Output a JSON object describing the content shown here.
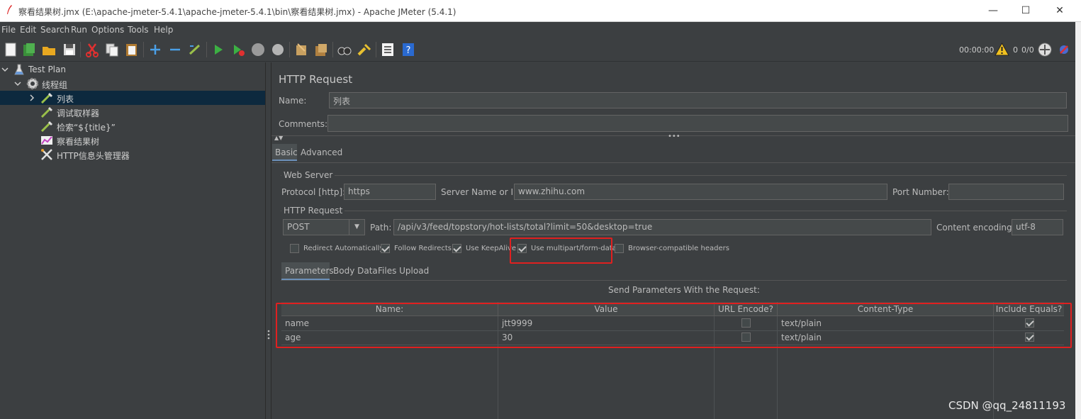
{
  "window": {
    "title": "察看结果树.jmx (E:\\apache-jmeter-5.4.1\\apache-jmeter-5.4.1\\bin\\察看结果树.jmx) - Apache JMeter (5.4.1)",
    "minimize": "—",
    "maximize": "☐",
    "close": "✕"
  },
  "menu": [
    "File",
    "Edit",
    "Search",
    "Run",
    "Options",
    "Tools",
    "Help"
  ],
  "toolbar": {
    "timer": "00:00:00",
    "warnings": "0",
    "threads": "0/0",
    "icons": [
      "new-icon",
      "templates-icon",
      "open-icon",
      "save-icon",
      "cut-icon",
      "copy-icon",
      "paste-icon",
      "expand-icon",
      "collapse-icon",
      "toggle-icon",
      "start-icon",
      "start-no-pause-icon",
      "stop-icon",
      "shutdown-icon",
      "clear-icon",
      "clear-all-icon",
      "search-icon",
      "reset-search-icon",
      "function-helper-icon",
      "help-icon"
    ]
  },
  "tree": {
    "items": [
      {
        "label": "Test Plan",
        "icon": "flask-icon"
      },
      {
        "label": "线程组",
        "icon": "gear-icon"
      },
      {
        "label": "列表",
        "icon": "pipette-icon"
      },
      {
        "label": "调试取样器",
        "icon": "pipette-icon"
      },
      {
        "label": "检索“${title}”",
        "icon": "pipette-icon"
      },
      {
        "label": "察看结果树",
        "icon": "graph-icon"
      },
      {
        "label": "HTTP信息头管理器",
        "icon": "tools-icon"
      }
    ]
  },
  "panel": {
    "title": "HTTP Request",
    "name_label": "Name:",
    "name_value": "列表",
    "comments_label": "Comments:",
    "comments_value": "",
    "tabs": [
      "Basic",
      "Advanced"
    ],
    "web_server": {
      "legend": "Web Server",
      "protocol_label": "Protocol [http]:",
      "protocol_value": "https",
      "server_label": "Server Name or IP:",
      "server_value": "www.zhihu.com",
      "port_label": "Port Number:",
      "port_value": ""
    },
    "http_request": {
      "legend": "HTTP Request",
      "method": "POST",
      "path_label": "Path:",
      "path_value": "/api/v3/feed/topstory/hot-lists/total?limit=50&desktop=true",
      "encoding_label": "Content encoding:",
      "encoding_value": "utf-8"
    },
    "options": [
      {
        "label": "Redirect Automatically",
        "checked": false
      },
      {
        "label": "Follow Redirects",
        "checked": true
      },
      {
        "label": "Use KeepAlive",
        "checked": true
      },
      {
        "label": "Use multipart/form-data",
        "checked": true
      },
      {
        "label": "Browser-compatible headers",
        "checked": false
      }
    ],
    "sub_tabs": [
      "Parameters",
      "Body Data",
      "Files Upload"
    ],
    "params_caption": "Send Parameters With the Request:",
    "columns": [
      "Name:",
      "Value",
      "URL Encode?",
      "Content-Type",
      "Include Equals?"
    ],
    "rows": [
      {
        "name": "name",
        "value": "jtt9999",
        "url_encode": false,
        "content_type": "text/plain",
        "include_equals": true
      },
      {
        "name": "age",
        "value": "30",
        "url_encode": false,
        "content_type": "text/plain",
        "include_equals": true
      }
    ]
  },
  "watermark": "CSDN @qq_24811193"
}
